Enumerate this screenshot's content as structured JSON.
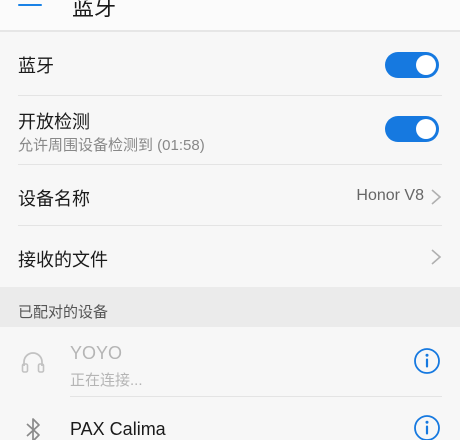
{
  "header": {
    "title": "蓝牙"
  },
  "bluetooth": {
    "label": "蓝牙",
    "enabled": true
  },
  "discovery": {
    "label": "开放检测",
    "sublabel": "允许周围设备检测到 (01:58)",
    "enabled": true
  },
  "device_name": {
    "label": "设备名称",
    "value": "Honor V8"
  },
  "received_files": {
    "label": "接收的文件"
  },
  "paired_section": {
    "title": "已配对的设备"
  },
  "paired_devices": [
    {
      "name": "YOYO",
      "status": "正在连接...",
      "icon": "headset-icon"
    },
    {
      "name": "PAX Calima",
      "status": "",
      "icon": "bluetooth-icon"
    }
  ],
  "colors": {
    "accent": "#1679e0",
    "toggle_on": "#1679e0",
    "disabled_text": "#b5b5b5"
  }
}
